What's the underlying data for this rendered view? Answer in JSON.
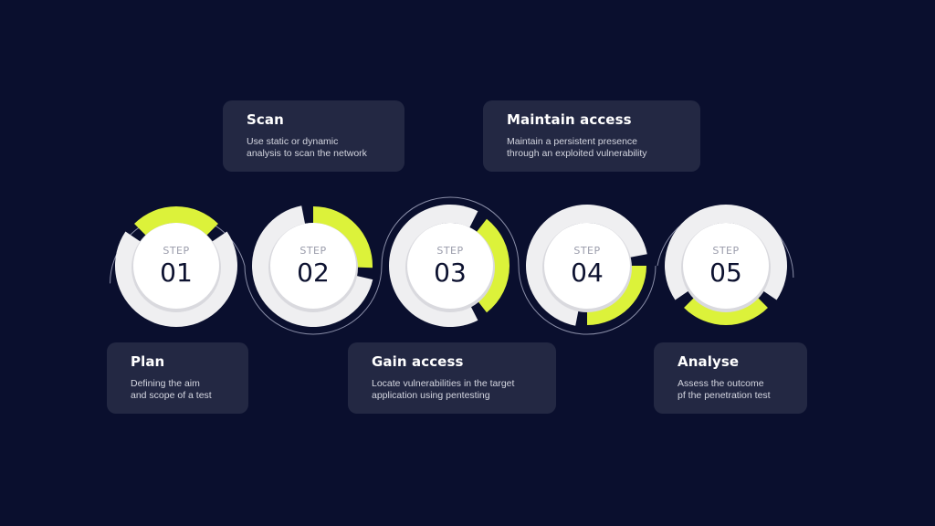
{
  "colors": {
    "background": "#0a0f2e",
    "card": "#232843",
    "accent": "#dcf23a",
    "ring": "#efeff1",
    "inner": "#ffffff",
    "number": "#0d1230",
    "connector": "#8a8ea8"
  },
  "steps": [
    {
      "label": "STEP",
      "number": "01",
      "title": "Plan",
      "desc_line1": "Defining the aim",
      "desc_line2": "and scope of a test",
      "card_position": "below"
    },
    {
      "label": "STEP",
      "number": "02",
      "title": "Scan",
      "desc_line1": "Use static or dynamic",
      "desc_line2": "analysis to scan the network",
      "card_position": "above"
    },
    {
      "label": "STEP",
      "number": "03",
      "title": "Gain access",
      "desc_line1": "Locate vulnerabilities in the target",
      "desc_line2": "application using pentesting",
      "card_position": "below"
    },
    {
      "label": "STEP",
      "number": "04",
      "title": "Maintain access",
      "desc_line1": "Maintain a persistent presence",
      "desc_line2": "through an exploited vulnerability",
      "card_position": "above"
    },
    {
      "label": "STEP",
      "number": "05",
      "title": "Analyse",
      "desc_line1": "Assess the outcome",
      "desc_line2": "pf the penetration test",
      "card_position": "below"
    }
  ]
}
